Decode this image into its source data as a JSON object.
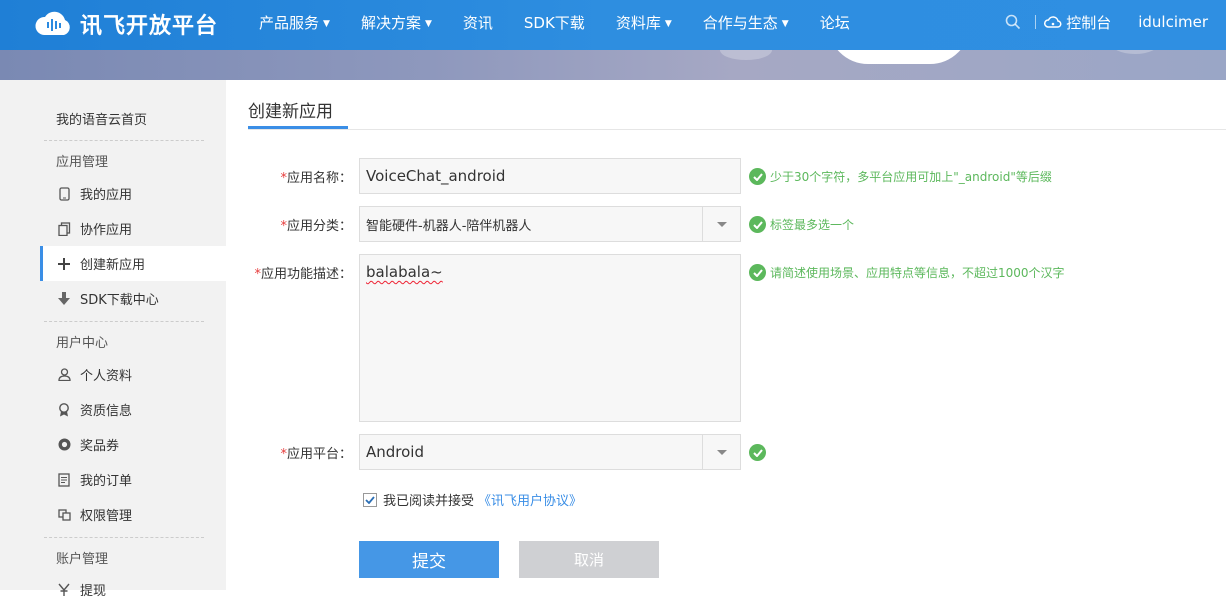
{
  "brand": {
    "name": "讯飞开放平台",
    "color": "#2b8ae0"
  },
  "nav": {
    "items": [
      {
        "label": "产品服务",
        "dropdown": true
      },
      {
        "label": "解决方案",
        "dropdown": true
      },
      {
        "label": "资讯",
        "dropdown": false
      },
      {
        "label": "SDK下载",
        "dropdown": false
      },
      {
        "label": "资料库",
        "dropdown": true
      },
      {
        "label": "合作与生态",
        "dropdown": true
      },
      {
        "label": "论坛",
        "dropdown": false
      }
    ],
    "console_label": "控制台",
    "username": "idulcimer"
  },
  "sidebar": {
    "home": "我的语音云首页",
    "groups": [
      {
        "title": "应用管理",
        "items": [
          "我的应用",
          "协作应用",
          "创建新应用",
          "SDK下载中心"
        ]
      },
      {
        "title": "用户中心",
        "items": [
          "个人资料",
          "资质信息",
          "奖品券",
          "我的订单",
          "权限管理"
        ]
      },
      {
        "title": "账户管理",
        "items": [
          "提现"
        ]
      }
    ],
    "active": "创建新应用"
  },
  "main": {
    "tab_title": "创建新应用",
    "form": {
      "app_name": {
        "label": "应用名称：",
        "value": "VoiceChat_android",
        "hint": "少于30个字符，多平台应用可加上\"_android\"等后缀"
      },
      "category": {
        "label": "应用分类：",
        "value": "智能硬件-机器人-陪伴机器人",
        "hint": "标签最多选一个"
      },
      "description": {
        "label": "应用功能描述：",
        "value": "balabala~",
        "hint": "请简述使用场景、应用特点等信息，不超过1000个汉字"
      },
      "platform": {
        "label": "应用平台：",
        "value": "Android"
      },
      "agreement": {
        "text": "我已阅读并接受",
        "link": "《讯飞用户协议》",
        "checked": true
      },
      "submit_label": "提交",
      "cancel_label": "取消"
    }
  },
  "colors": {
    "accent": "#3a8ee6",
    "ok": "#5cb85c",
    "required": "#e63b3b"
  }
}
